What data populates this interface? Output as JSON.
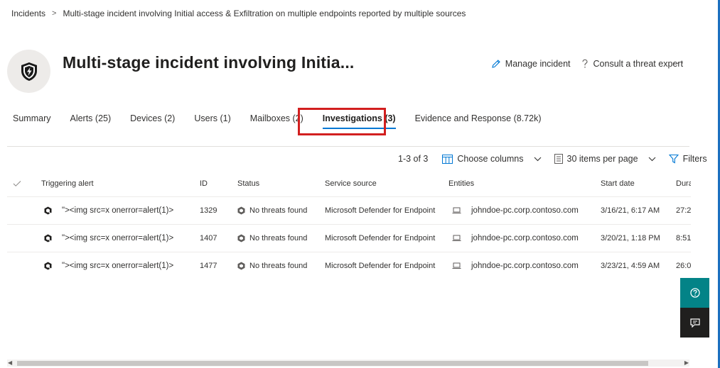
{
  "breadcrumb": {
    "root": "Incidents",
    "separator": ">",
    "current": "Multi-stage incident involving Initial access & Exfiltration on multiple endpoints reported by multiple sources"
  },
  "header": {
    "title": "Multi-stage incident involving Initia...",
    "manage_label": "Manage incident",
    "consult_label": "Consult a threat expert",
    "more_label": "···"
  },
  "tabs": [
    {
      "label": "Summary"
    },
    {
      "label": "Alerts (25)"
    },
    {
      "label": "Devices (2)"
    },
    {
      "label": "Users (1)"
    },
    {
      "label": "Mailboxes (2)"
    },
    {
      "label": "Investigations (3)",
      "active": true
    },
    {
      "label": "Evidence and Response (8.72k)"
    }
  ],
  "toolbar": {
    "count": "1-3 of 3",
    "choose_columns": "Choose columns",
    "per_page": "30 items per page",
    "filters": "Filters"
  },
  "table": {
    "columns": [
      "Triggering alert",
      "ID",
      "Status",
      "Service source",
      "Entities",
      "Start date",
      "Dura"
    ],
    "rows": [
      {
        "alert": "\"><img src=x onerror=alert(1)>",
        "id": "1329",
        "status": "No threats found",
        "source": "Microsoft Defender for Endpoint",
        "entity": "johndoe-pc.corp.contoso.com",
        "start": "3/16/21, 6:17 AM",
        "duration": "27:2"
      },
      {
        "alert": "\"><img src=x onerror=alert(1)>",
        "id": "1407",
        "status": "No threats found",
        "source": "Microsoft Defender for Endpoint",
        "entity": "johndoe-pc.corp.contoso.com",
        "start": "3/20/21, 1:18 PM",
        "duration": "8:51"
      },
      {
        "alert": "\"><img src=x onerror=alert(1)>",
        "id": "1477",
        "status": "No threats found",
        "source": "Microsoft Defender for Endpoint",
        "entity": "johndoe-pc.corp.contoso.com",
        "start": "3/23/21, 4:59 AM",
        "duration": "26:0"
      }
    ]
  },
  "colors": {
    "accent": "#0078d4",
    "highlight": "#d21f1f",
    "help_fab": "#038387",
    "chat_fab": "#201f1e"
  },
  "icons": {
    "hero": "shield-bolt-icon",
    "manage": "pencil-icon",
    "consult": "question-icon",
    "columns": "columns-icon",
    "per_page": "list-icon",
    "filters": "filter-icon",
    "alert": "investigation-hex-icon",
    "status": "status-hex-icon",
    "entity": "laptop-icon",
    "help": "help-icon",
    "chat": "chat-icon"
  }
}
